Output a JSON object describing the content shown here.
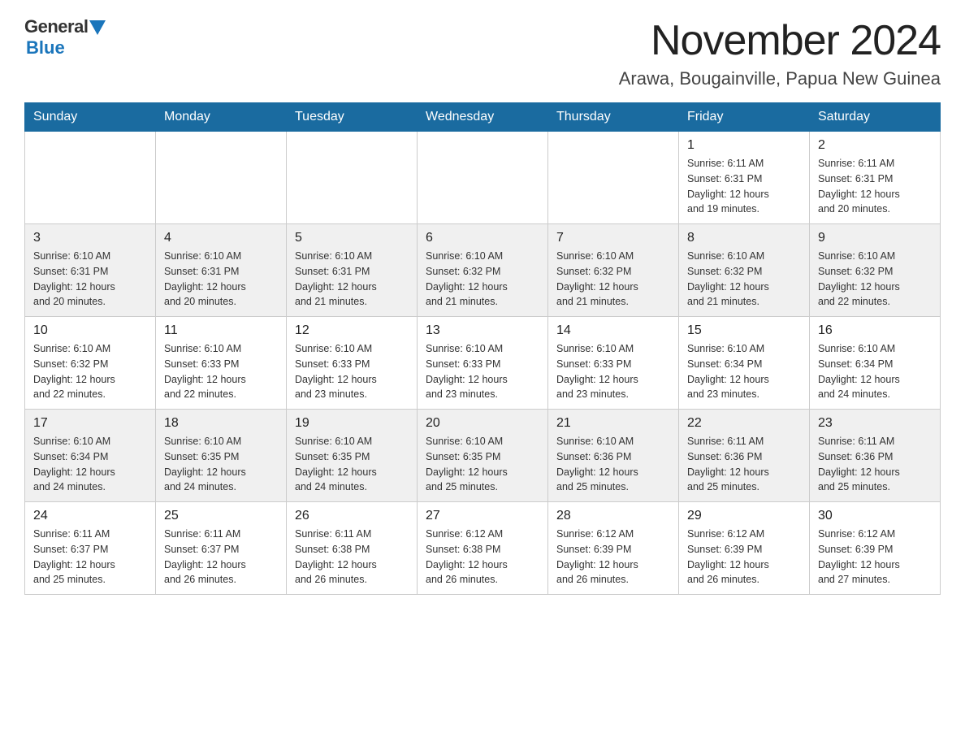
{
  "header": {
    "logo_general": "General",
    "logo_blue": "Blue",
    "month_title": "November 2024",
    "location": "Arawa, Bougainville, Papua New Guinea"
  },
  "days_header": [
    "Sunday",
    "Monday",
    "Tuesday",
    "Wednesday",
    "Thursday",
    "Friday",
    "Saturday"
  ],
  "weeks": [
    [
      {
        "day": "",
        "info": ""
      },
      {
        "day": "",
        "info": ""
      },
      {
        "day": "",
        "info": ""
      },
      {
        "day": "",
        "info": ""
      },
      {
        "day": "",
        "info": ""
      },
      {
        "day": "1",
        "info": "Sunrise: 6:11 AM\nSunset: 6:31 PM\nDaylight: 12 hours\nand 19 minutes."
      },
      {
        "day": "2",
        "info": "Sunrise: 6:11 AM\nSunset: 6:31 PM\nDaylight: 12 hours\nand 20 minutes."
      }
    ],
    [
      {
        "day": "3",
        "info": "Sunrise: 6:10 AM\nSunset: 6:31 PM\nDaylight: 12 hours\nand 20 minutes."
      },
      {
        "day": "4",
        "info": "Sunrise: 6:10 AM\nSunset: 6:31 PM\nDaylight: 12 hours\nand 20 minutes."
      },
      {
        "day": "5",
        "info": "Sunrise: 6:10 AM\nSunset: 6:31 PM\nDaylight: 12 hours\nand 21 minutes."
      },
      {
        "day": "6",
        "info": "Sunrise: 6:10 AM\nSunset: 6:32 PM\nDaylight: 12 hours\nand 21 minutes."
      },
      {
        "day": "7",
        "info": "Sunrise: 6:10 AM\nSunset: 6:32 PM\nDaylight: 12 hours\nand 21 minutes."
      },
      {
        "day": "8",
        "info": "Sunrise: 6:10 AM\nSunset: 6:32 PM\nDaylight: 12 hours\nand 21 minutes."
      },
      {
        "day": "9",
        "info": "Sunrise: 6:10 AM\nSunset: 6:32 PM\nDaylight: 12 hours\nand 22 minutes."
      }
    ],
    [
      {
        "day": "10",
        "info": "Sunrise: 6:10 AM\nSunset: 6:32 PM\nDaylight: 12 hours\nand 22 minutes."
      },
      {
        "day": "11",
        "info": "Sunrise: 6:10 AM\nSunset: 6:33 PM\nDaylight: 12 hours\nand 22 minutes."
      },
      {
        "day": "12",
        "info": "Sunrise: 6:10 AM\nSunset: 6:33 PM\nDaylight: 12 hours\nand 23 minutes."
      },
      {
        "day": "13",
        "info": "Sunrise: 6:10 AM\nSunset: 6:33 PM\nDaylight: 12 hours\nand 23 minutes."
      },
      {
        "day": "14",
        "info": "Sunrise: 6:10 AM\nSunset: 6:33 PM\nDaylight: 12 hours\nand 23 minutes."
      },
      {
        "day": "15",
        "info": "Sunrise: 6:10 AM\nSunset: 6:34 PM\nDaylight: 12 hours\nand 23 minutes."
      },
      {
        "day": "16",
        "info": "Sunrise: 6:10 AM\nSunset: 6:34 PM\nDaylight: 12 hours\nand 24 minutes."
      }
    ],
    [
      {
        "day": "17",
        "info": "Sunrise: 6:10 AM\nSunset: 6:34 PM\nDaylight: 12 hours\nand 24 minutes."
      },
      {
        "day": "18",
        "info": "Sunrise: 6:10 AM\nSunset: 6:35 PM\nDaylight: 12 hours\nand 24 minutes."
      },
      {
        "day": "19",
        "info": "Sunrise: 6:10 AM\nSunset: 6:35 PM\nDaylight: 12 hours\nand 24 minutes."
      },
      {
        "day": "20",
        "info": "Sunrise: 6:10 AM\nSunset: 6:35 PM\nDaylight: 12 hours\nand 25 minutes."
      },
      {
        "day": "21",
        "info": "Sunrise: 6:10 AM\nSunset: 6:36 PM\nDaylight: 12 hours\nand 25 minutes."
      },
      {
        "day": "22",
        "info": "Sunrise: 6:11 AM\nSunset: 6:36 PM\nDaylight: 12 hours\nand 25 minutes."
      },
      {
        "day": "23",
        "info": "Sunrise: 6:11 AM\nSunset: 6:36 PM\nDaylight: 12 hours\nand 25 minutes."
      }
    ],
    [
      {
        "day": "24",
        "info": "Sunrise: 6:11 AM\nSunset: 6:37 PM\nDaylight: 12 hours\nand 25 minutes."
      },
      {
        "day": "25",
        "info": "Sunrise: 6:11 AM\nSunset: 6:37 PM\nDaylight: 12 hours\nand 26 minutes."
      },
      {
        "day": "26",
        "info": "Sunrise: 6:11 AM\nSunset: 6:38 PM\nDaylight: 12 hours\nand 26 minutes."
      },
      {
        "day": "27",
        "info": "Sunrise: 6:12 AM\nSunset: 6:38 PM\nDaylight: 12 hours\nand 26 minutes."
      },
      {
        "day": "28",
        "info": "Sunrise: 6:12 AM\nSunset: 6:39 PM\nDaylight: 12 hours\nand 26 minutes."
      },
      {
        "day": "29",
        "info": "Sunrise: 6:12 AM\nSunset: 6:39 PM\nDaylight: 12 hours\nand 26 minutes."
      },
      {
        "day": "30",
        "info": "Sunrise: 6:12 AM\nSunset: 6:39 PM\nDaylight: 12 hours\nand 27 minutes."
      }
    ]
  ]
}
